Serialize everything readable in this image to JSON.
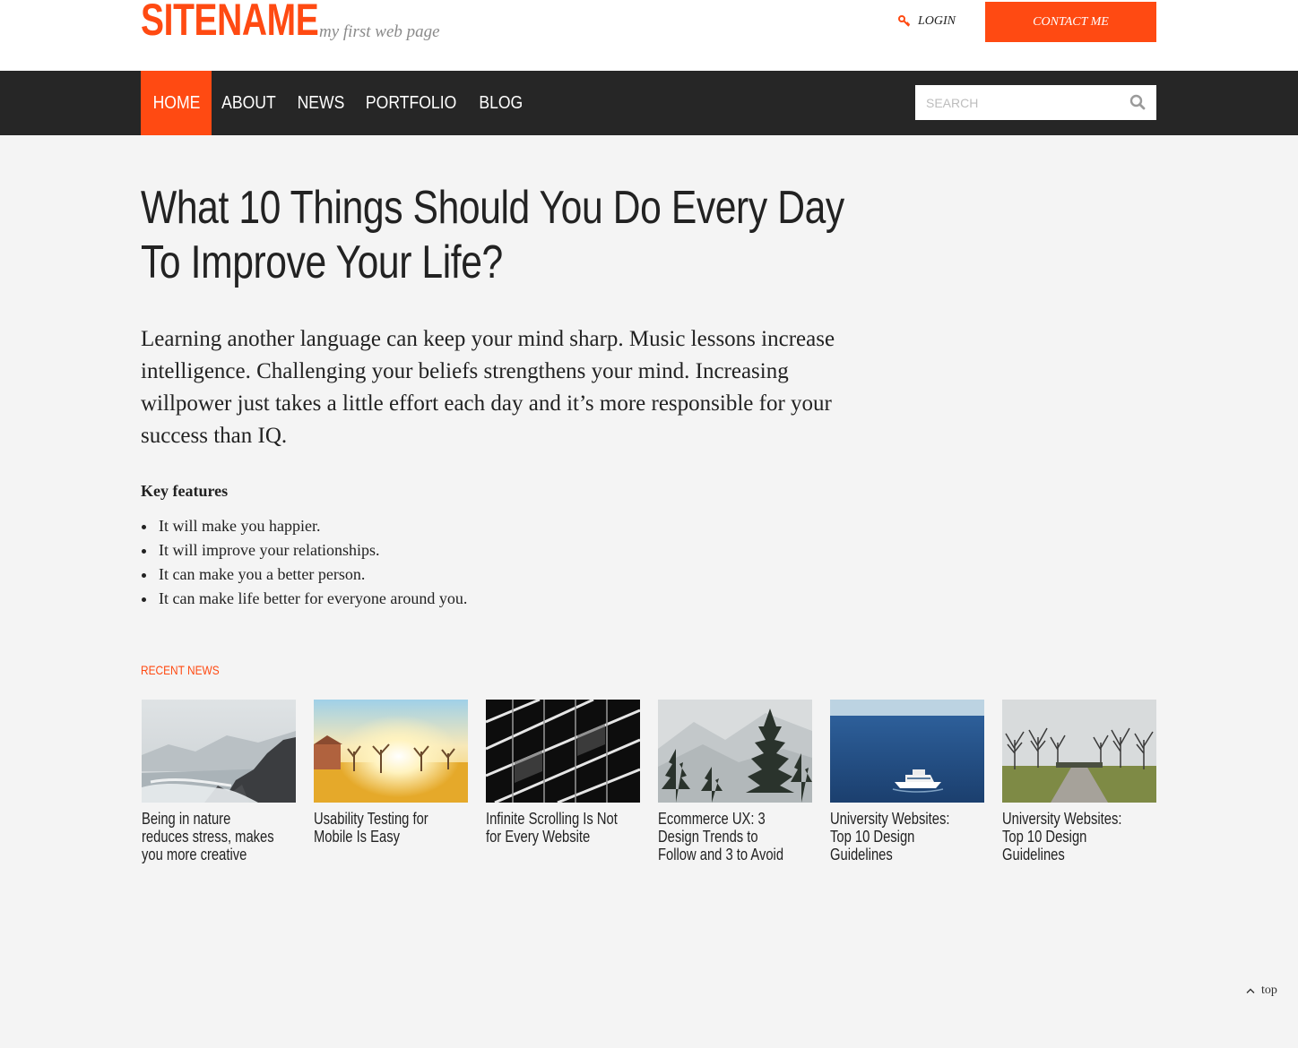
{
  "header": {
    "logo": "SITENAME",
    "tagline": "my first web page",
    "login_label": "LOGIN",
    "contact_label": "CONTACT ME"
  },
  "nav": {
    "items": [
      {
        "label": "HOME",
        "active": true
      },
      {
        "label": "ABOUT",
        "active": false
      },
      {
        "label": "NEWS",
        "active": false
      },
      {
        "label": "PORTFOLIO",
        "active": false
      },
      {
        "label": "BLOG",
        "active": false
      }
    ],
    "search_placeholder": "SEARCH"
  },
  "article": {
    "title_line1": "What 10 Things Should You Do Every Day",
    "title_line2": "To Improve Your Life?",
    "lead": "Learning another language can keep your mind sharp. Music lessons increase intelligence. Challenging your beliefs strengthens your mind.  Increasing willpower just takes a little effort each day and it’s more responsible for your success than IQ.",
    "key_features_title": "Key features",
    "features": [
      "It will make you happier.",
      "It will improve your relationships.",
      "It can make you a better person.",
      "It can make life better for everyone around you."
    ]
  },
  "recent_news": {
    "title": "RECENT NEWS",
    "items": [
      {
        "caption": "Being in nature reduces stress, makes you more creative",
        "image": "misty-coast-photo"
      },
      {
        "caption": "Usability Testing for Mobile Is Easy",
        "image": "sunlit-orchard-photo"
      },
      {
        "caption": "Infinite Scrolling Is Not for Every Website",
        "image": "building-facade-photo"
      },
      {
        "caption": "Ecommerce UX: 3 Design Trends to Follow and 3 to Avoid",
        "image": "snowy-forest-photo"
      },
      {
        "caption": "University Websites: Top 10 Design Guidelines",
        "image": "yacht-at-sea-photo"
      },
      {
        "caption": "University Websites: Top 10 Design Guidelines",
        "image": "tree-lined-path-photo"
      }
    ]
  },
  "footer": {
    "top_label": "top"
  },
  "colors": {
    "accent": "#ff4a12",
    "nav_bg": "#262626",
    "page_bg": "#f4f4f4"
  }
}
